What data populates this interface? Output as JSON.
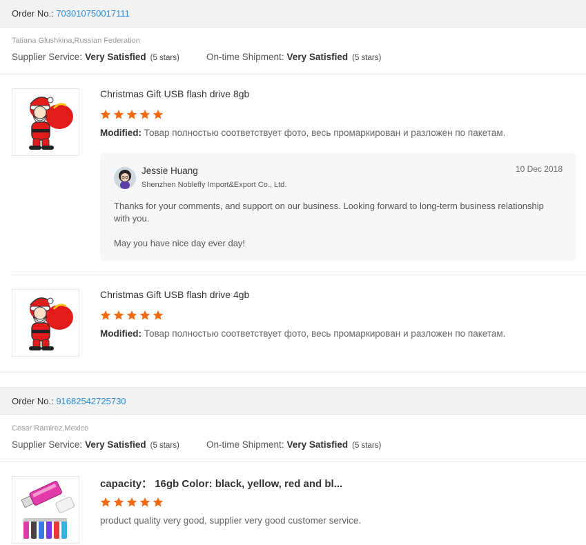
{
  "colors": {
    "accent_link": "#2d8bd6",
    "star": "#f36a12",
    "header_bg": "#f2f2f2"
  },
  "orders": [
    {
      "order_label": "Order No.:",
      "order_number": "703010750017111",
      "buyer": "Tatiana Glushkina,Russian Federation",
      "supplier_service_label": "Supplier Service:",
      "supplier_service_value": "Very Satisfied",
      "supplier_service_stars": "(5 stars)",
      "shipment_label": "On-time Shipment:",
      "shipment_value": "Very Satisfied",
      "shipment_stars": "(5 stars)",
      "items": [
        {
          "title": "Christmas Gift USB flash drive 8gb",
          "rating": 5,
          "modified_label": "Modified:",
          "feedback": "Товар полностью соответствует фото, весь промаркирован и разложен по пакетам.",
          "reply": {
            "name": "Jessie Huang",
            "company": "Shenzhen Noblefly Import&Export Co., Ltd.",
            "date": "10 Dec 2018",
            "paragraph1": "Thanks for your comments, and support on our business. Looking forward to long-term business relationship with you.",
            "paragraph2": "May you have nice day ever day!"
          }
        },
        {
          "title": "Christmas Gift USB flash drive 4gb",
          "rating": 5,
          "modified_label": "Modified:",
          "feedback": "Товар полностью соответствует фото, весь промаркирован и разложен по пакетам."
        }
      ]
    },
    {
      "order_label": "Order No.:",
      "order_number": "91682542725730",
      "buyer": "Cesar Ramirez,Mexico",
      "supplier_service_label": "Supplier Service:",
      "supplier_service_value": "Very Satisfied",
      "supplier_service_stars": "(5 stars)",
      "shipment_label": "On-time Shipment:",
      "shipment_value": "Very Satisfied",
      "shipment_stars": "(5 stars)",
      "items": [
        {
          "title": "capacity： 16gb Color: black, yellow, red and bl...",
          "rating": 5,
          "feedback": "product quality very good, supplier very good customer service."
        }
      ]
    }
  ]
}
